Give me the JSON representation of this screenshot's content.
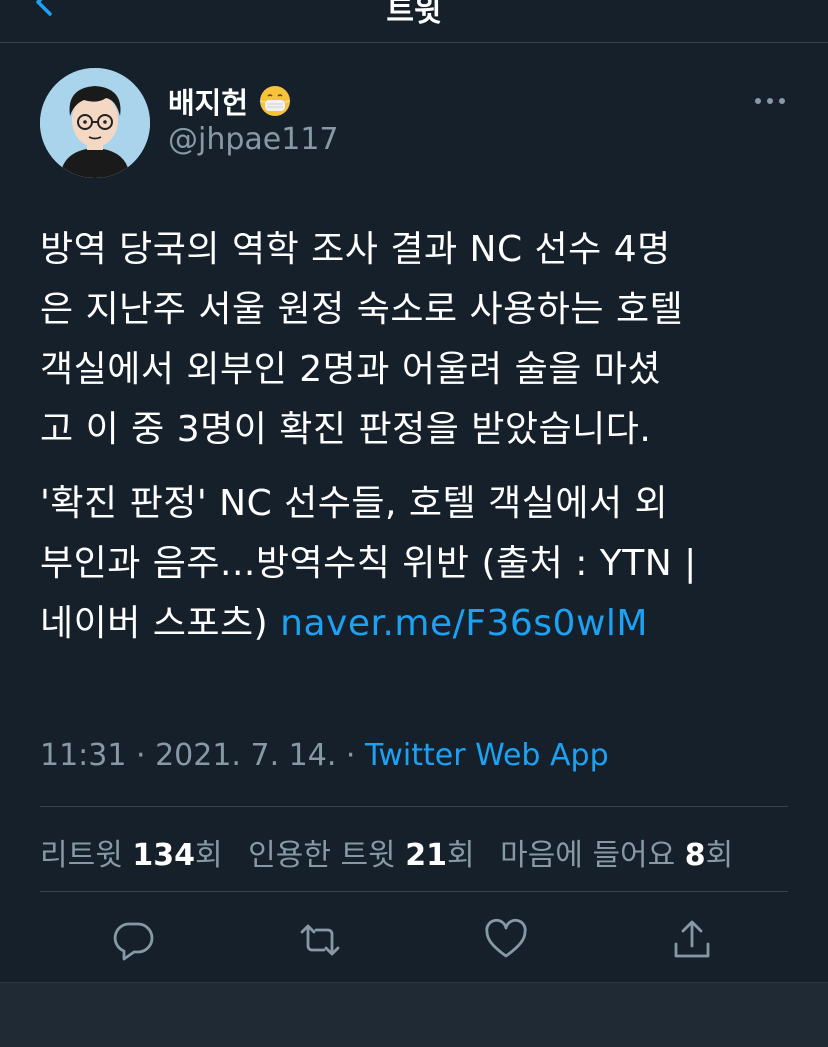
{
  "header": {
    "title": "트윗"
  },
  "author": {
    "name": "배지헌",
    "handle": "@jhpae117",
    "status_emoji": "mask-face"
  },
  "tweet": {
    "paragraph1_lines": [
      "방역 당국의 역학 조사 결과 NC 선수 4명",
      "은 지난주 서울 원정 숙소로 사용하는 호텔",
      "객실에서 외부인 2명과 어울려 술을 마셨",
      "고 이 중 3명이 확진 판정을 받았습니다."
    ],
    "paragraph2_lines": [
      "'확진 판정' NC 선수들, 호텔 객실에서 외",
      "부인과 음주...방역수칙 위반 (출처 : YTN |",
      "네이버 스포츠) "
    ],
    "link_text": "naver.me/F36s0wlM"
  },
  "meta": {
    "time": "11:31",
    "sep1": " · ",
    "date": "2021. 7. 14.",
    "sep2": " · ",
    "source": "Twitter Web App"
  },
  "stats": {
    "retweets_label": "리트윗 ",
    "retweets_count": "134",
    "retweets_suffix": "회",
    "quotes_label": "인용한 트윗 ",
    "quotes_count": "21",
    "quotes_suffix": "회",
    "likes_label": "마음에 들어요 ",
    "likes_count": "8",
    "likes_suffix": "회"
  },
  "actions": [
    "reply-icon",
    "retweet-icon",
    "like-icon",
    "share-icon"
  ],
  "colors": {
    "background": "#15202b",
    "accent": "#1da1f2",
    "secondary_text": "#8899a6",
    "divider": "#38444d"
  }
}
